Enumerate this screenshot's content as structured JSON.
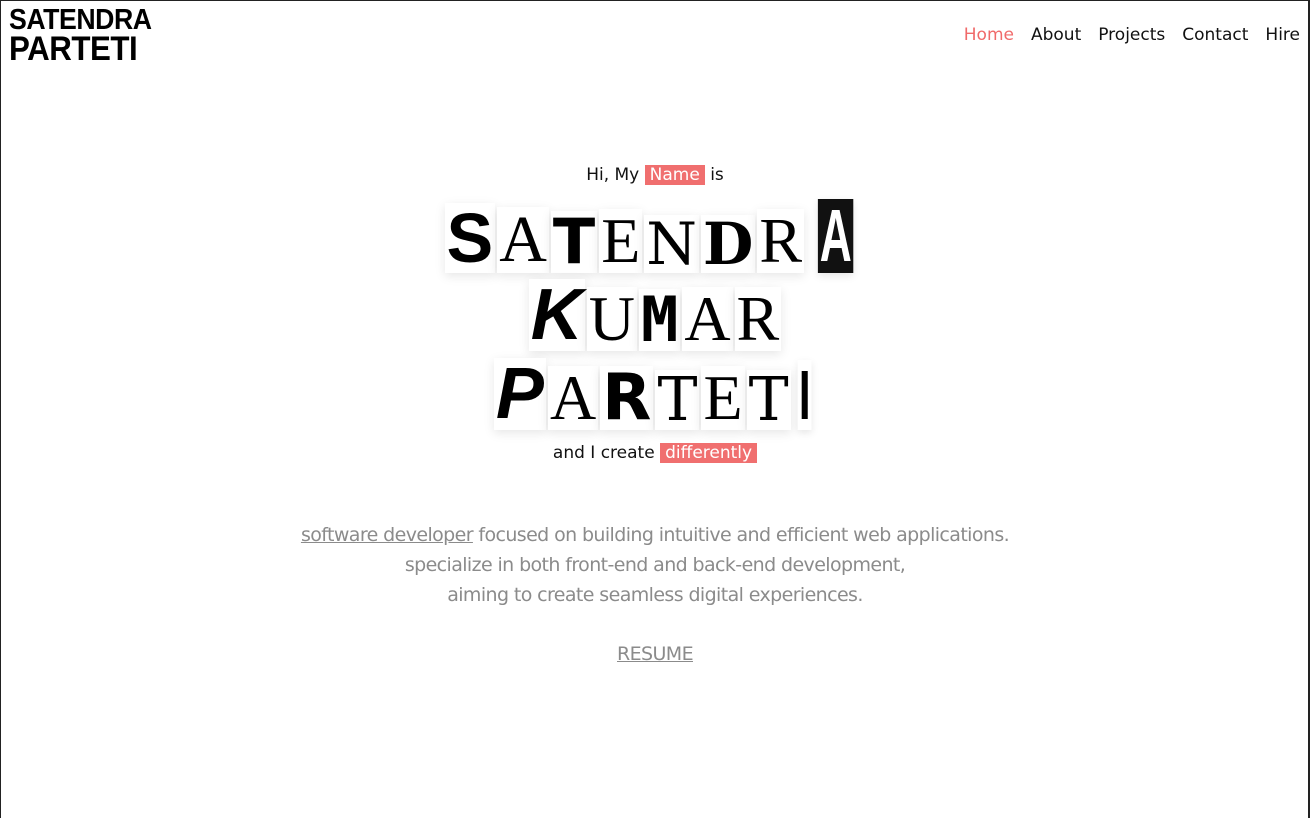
{
  "logo": {
    "line1": "SATENDRA",
    "line2": "PARTETI"
  },
  "nav": {
    "items": [
      "Home",
      "About",
      "Projects",
      "Contact",
      "Hire"
    ],
    "active": "Home"
  },
  "hero": {
    "intro_prefix": "Hi, My",
    "intro_highlight": "Name",
    "intro_suffix": "is",
    "name_lines": [
      [
        "S",
        "A",
        "T",
        "E",
        "N",
        "D",
        "R",
        "A"
      ],
      [
        "K",
        "U",
        "M",
        "A",
        "R"
      ],
      [
        "P",
        "A",
        "R",
        "T",
        "E",
        "T",
        "I"
      ]
    ],
    "create_prefix": "and I create",
    "create_highlight": "differently"
  },
  "description": {
    "link_text": "software developer",
    "line1_rest": "focused on building intuitive and efficient web applications.",
    "line2": "specialize in both front-end and back-end development,",
    "line3": "aiming to create seamless digital experiences."
  },
  "resume_label": "RESUME",
  "colors": {
    "accent": "#f06f6f",
    "muted_text": "#8b8b8b",
    "text": "#111111"
  }
}
